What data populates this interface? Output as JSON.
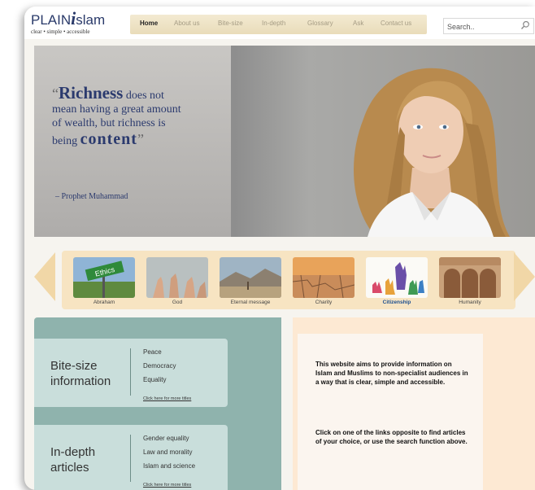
{
  "logo": {
    "plain": "PLAIN",
    "i": "i",
    "slam": "slam",
    "tagline": "clear • simple • accessible"
  },
  "nav": {
    "items": [
      {
        "label": "Home",
        "active": true
      },
      {
        "label": "About us",
        "active": false
      },
      {
        "label": "Bite-size",
        "active": false
      },
      {
        "label": "In-depth",
        "active": false
      },
      {
        "label": "Glossary",
        "active": false
      },
      {
        "label": "Ask",
        "active": false
      },
      {
        "label": "Contact us",
        "active": false
      }
    ]
  },
  "search": {
    "value": "Search..",
    "icon": "search-icon"
  },
  "hero": {
    "open_quote": "“",
    "word1": "Richness",
    "line1_rest": " does not",
    "line2": "mean having a great amount",
    "line3": "of wealth, but richness is",
    "line4_pre": "being ",
    "word2": "content",
    "close_quote": "”",
    "attribution": "– Prophet Muhammad"
  },
  "carousel": {
    "items": [
      {
        "label": "Abraham",
        "badge": "Ethics",
        "active": false
      },
      {
        "label": "God",
        "active": false
      },
      {
        "label": "Eternal message",
        "active": false
      },
      {
        "label": "Charity",
        "active": false
      },
      {
        "label": "Citizenship",
        "active": true
      },
      {
        "label": "Humanity",
        "active": false
      }
    ]
  },
  "bite_size": {
    "title_line1": "Bite-size",
    "title_line2": "information",
    "links": [
      "Peace",
      "Democracy",
      "Equality"
    ],
    "more": "Click here for more titles"
  },
  "in_depth": {
    "title_line1": "In-depth",
    "title_line2": "articles",
    "links": [
      "Gender equality",
      "Law and morality",
      "Islam and science"
    ],
    "more": "Click here for more titles"
  },
  "info": {
    "paragraph1": "This website aims to provide information on Islam and Muslims to non-specialist audiences in a way that is clear, simple and accessible.",
    "paragraph2": "Click on one of the links opposite to find articles of your choice, or use the search function above."
  },
  "colors": {
    "navy": "#2b3a6e",
    "teal_panel": "#8fb3ad",
    "teal_card": "#c9dedb",
    "peach": "#fde9d3",
    "nav_bg": "#eee2c4"
  }
}
